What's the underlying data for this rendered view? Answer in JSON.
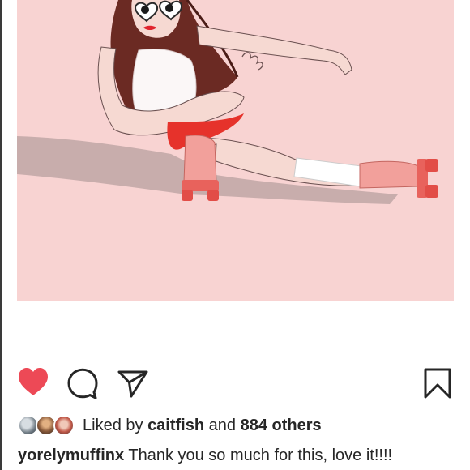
{
  "post": {
    "image_alt": "Illustration of a woman in heart sunglasses on pink roller skates",
    "colors": {
      "background": "#f8d3d2",
      "like_heart": "#ed4956",
      "text": "#262626"
    }
  },
  "actions": {
    "like_icon": "heart-filled-icon",
    "comment_icon": "comment-bubble-icon",
    "share_icon": "paper-plane-icon",
    "save_icon": "bookmark-icon"
  },
  "likes": {
    "prefix": "Liked by",
    "first_user": "caitfish",
    "conjunction": "and",
    "others": "884 others",
    "avatars": [
      "avatar-1",
      "avatar-2",
      "avatar-3"
    ]
  },
  "caption": {
    "username": "yorelymuffinx",
    "text": "Thank you so much for this, love it!!!!"
  }
}
